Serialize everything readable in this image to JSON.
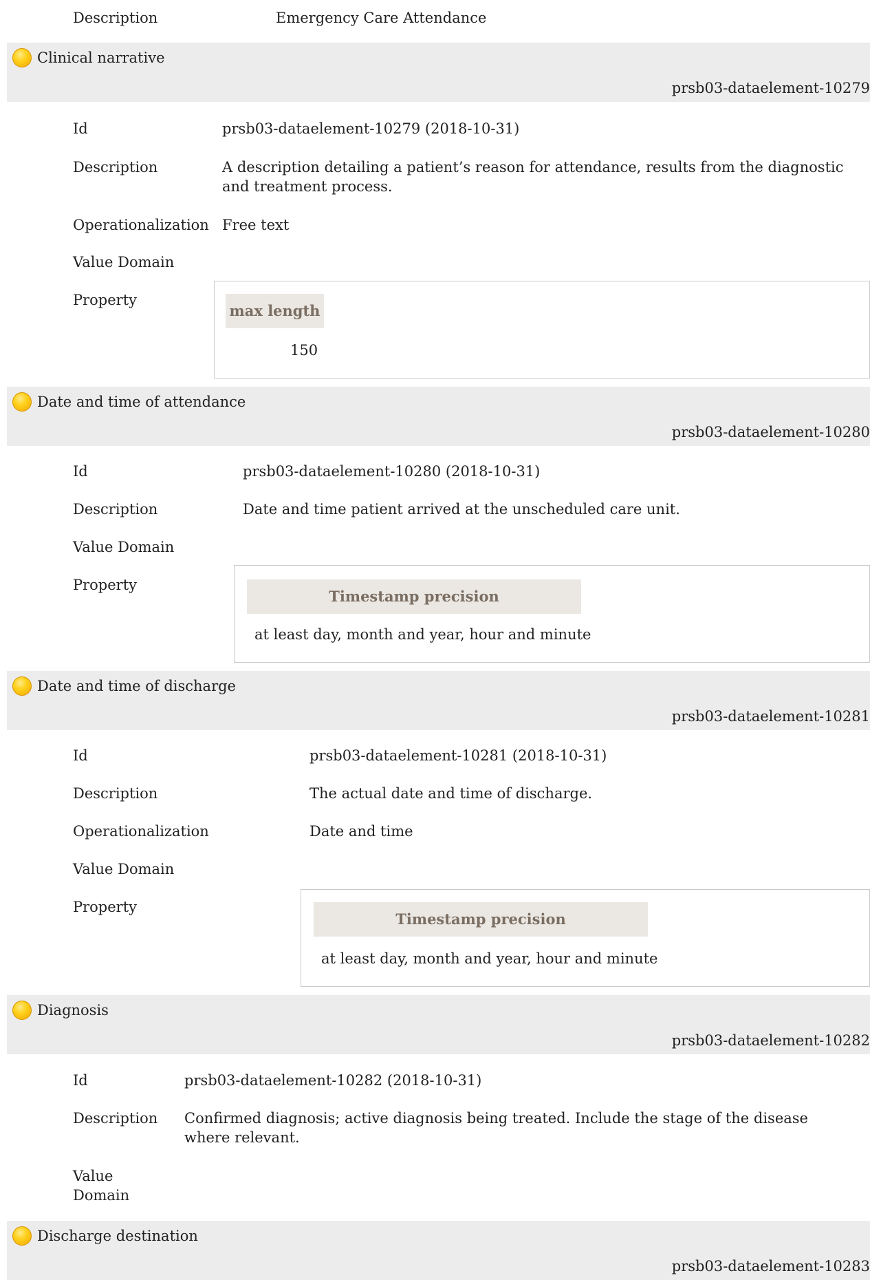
{
  "top": {
    "label": "Description",
    "value": "Emergency Care Attendance"
  },
  "sections": [
    {
      "title": "Clinical narrative",
      "element_id": "prsb03-dataelement-10279",
      "id_label": "Id",
      "id_value": "prsb03-dataelement-10279 (2018-10-31)",
      "description_label": "Description",
      "description": "A description detailing a patient’s reason for attendance, results from the diagnostic and treatment process.",
      "operationalization_label": "Operationalization",
      "operationalization": "Free text",
      "value_domain_label": "Value Domain",
      "property_label": "Property",
      "property_header": "max length",
      "property_value": "150"
    },
    {
      "title": "Date and time of attendance",
      "element_id": "prsb03-dataelement-10280",
      "id_label": "Id",
      "id_value": "prsb03-dataelement-10280 (2018-10-31)",
      "description_label": "Description",
      "description": "Date and time patient arrived at the unscheduled care unit.",
      "value_domain_label": "Value Domain",
      "property_label": "Property",
      "property_header": "Timestamp precision",
      "property_value": "at least day, month and year, hour and minute"
    },
    {
      "title": "Date and time of discharge",
      "element_id": "prsb03-dataelement-10281",
      "id_label": "Id",
      "id_value": "prsb03-dataelement-10281 (2018-10-31)",
      "description_label": "Description",
      "description": "The actual date and time of discharge.",
      "operationalization_label": "Operationalization",
      "operationalization": "Date and time",
      "value_domain_label": "Value Domain",
      "property_label": "Property",
      "property_header": "Timestamp precision",
      "property_value": "at least day, month and year, hour and minute"
    },
    {
      "title": "Diagnosis",
      "element_id": "prsb03-dataelement-10282",
      "id_label": "Id",
      "id_value": "prsb03-dataelement-10282 (2018-10-31)",
      "description_label": "Description",
      "description": "Confirmed diagnosis; active diagnosis being treated. Include the stage of the disease where relevant.",
      "value_domain_label_line1": "Value",
      "value_domain_label_line2": "Domain"
    },
    {
      "title": "Discharge destination",
      "element_id": "prsb03-dataelement-10283"
    }
  ],
  "icons": {
    "section_marker": "yellow-circle-icon"
  },
  "colors": {
    "bar_bg": "#ececec",
    "marker": "#ffc400",
    "property_header_bg": "#ebe7e2",
    "property_header_text": "#7a6e63"
  }
}
